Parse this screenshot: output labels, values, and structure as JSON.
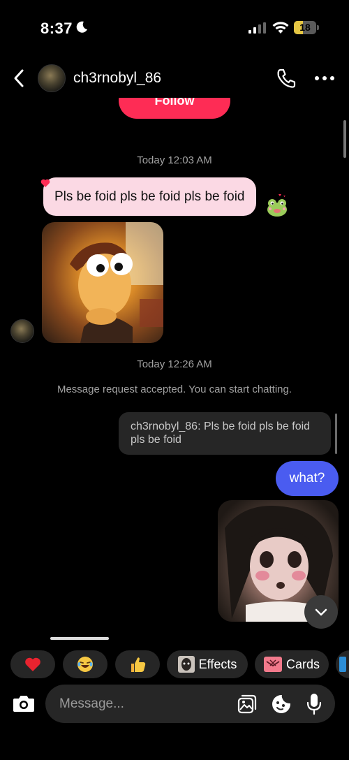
{
  "status_bar": {
    "time": "8:37",
    "battery": "18"
  },
  "header": {
    "username": "ch3rnobyl_86"
  },
  "follow_button": {
    "label": "Follow"
  },
  "timestamps": [
    "Today 12:03 AM",
    "Today 12:26 AM"
  ],
  "messages": {
    "incoming_text": "Pls be foid pls be foid pls be foid",
    "system": "Message request accepted. You can start chatting.",
    "reply_quote": "ch3rnobyl_86: Pls be foid pls be foid pls be foid",
    "outgoing_text": "what?"
  },
  "quick_actions": [
    {
      "icon": "heart-emoji"
    },
    {
      "icon": "laughing-emoji"
    },
    {
      "icon": "thumbs-up-emoji"
    },
    {
      "icon": "effects-thumbnail",
      "label": "Effects"
    },
    {
      "icon": "cards-icon",
      "label": "Cards"
    }
  ],
  "composer": {
    "placeholder": "Message..."
  },
  "colors": {
    "accent_pink": "#fe2c55",
    "incoming_bubble": "#fbd9e4",
    "outgoing_bubble": "#4a5cf0"
  }
}
